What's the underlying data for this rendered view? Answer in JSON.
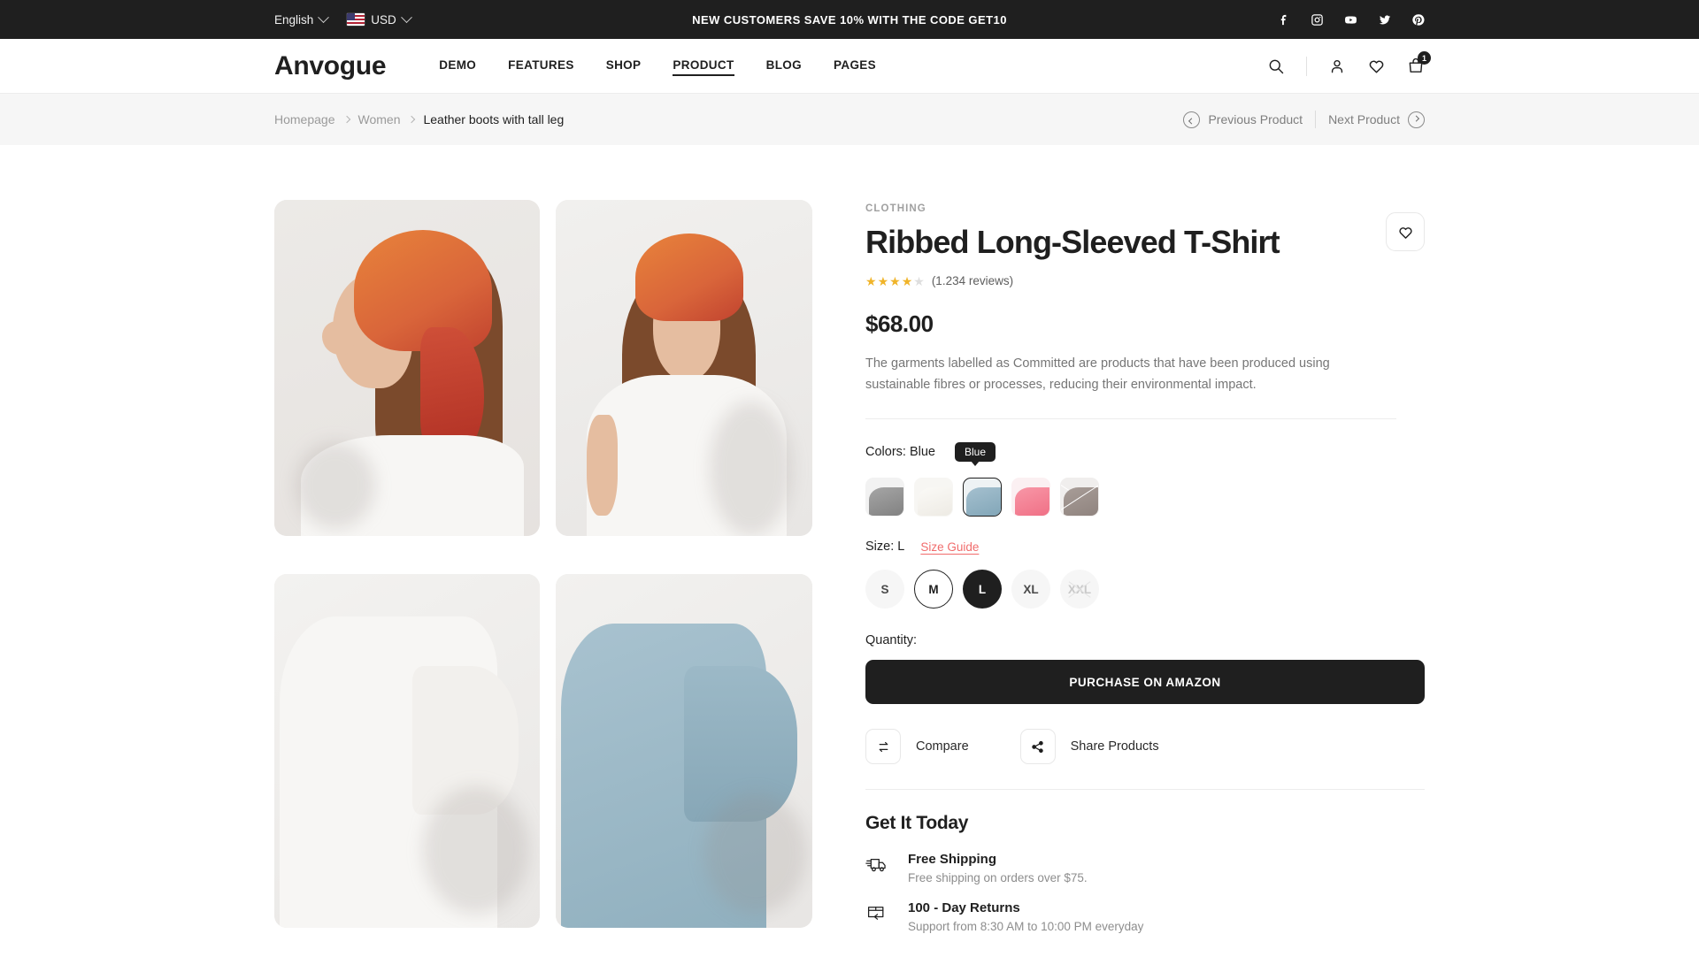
{
  "topbar": {
    "language": "English",
    "currency": "USD",
    "flag_icon": "us-flag-icon",
    "promo": "NEW CUSTOMERS SAVE 10% WITH THE CODE GET10",
    "socials": [
      {
        "name": "facebook-icon"
      },
      {
        "name": "instagram-icon"
      },
      {
        "name": "youtube-icon"
      },
      {
        "name": "twitter-icon"
      },
      {
        "name": "pinterest-icon"
      }
    ]
  },
  "header": {
    "logo": "Anvogue",
    "nav": [
      {
        "label": "DEMO",
        "active": false
      },
      {
        "label": "FEATURES",
        "active": false
      },
      {
        "label": "SHOP",
        "active": false
      },
      {
        "label": "PRODUCT",
        "active": true
      },
      {
        "label": "BLOG",
        "active": false
      },
      {
        "label": "PAGES",
        "active": false
      }
    ],
    "cart_count": "1"
  },
  "breadcrumb": {
    "items": [
      {
        "label": "Homepage",
        "current": false
      },
      {
        "label": "Women",
        "current": false
      },
      {
        "label": "Leather boots with tall leg",
        "current": true
      }
    ],
    "previous_label": "Previous Product",
    "next_label": "Next Product"
  },
  "product": {
    "category": "CLOTHING",
    "title": "Ribbed Long-Sleeved T-Shirt",
    "rating_filled": 4,
    "rating_total": 5,
    "reviews": "(1.234 reviews)",
    "price": "$68.00",
    "description": "The garments labelled as Committed are products that have been produced using sustainable fibres or processes, reducing their environmental impact.",
    "colors_label": "Colors: Blue",
    "color_tooltip": "Blue",
    "colors": [
      {
        "name": "Gray",
        "hex": "#8e8e8e",
        "bg": "#f2f2f2",
        "selected": false,
        "disabled": false
      },
      {
        "name": "White",
        "hex": "#f3f1ec",
        "bg": "#f5f4f1",
        "selected": false,
        "disabled": false
      },
      {
        "name": "Blue",
        "hex": "#8fb0c0",
        "bg": "#eef2f4",
        "selected": true,
        "disabled": false
      },
      {
        "name": "Pink",
        "hex": "#f4879a",
        "bg": "#fbf0f2",
        "selected": false,
        "disabled": false
      },
      {
        "name": "Taupe",
        "hex": "#9b8f8a",
        "bg": "#f0eeed",
        "selected": false,
        "disabled": true
      }
    ],
    "size_label": "Size: L",
    "size_guide": "Size Guide",
    "sizes": [
      {
        "label": "S",
        "state": "default"
      },
      {
        "label": "M",
        "state": "outlined"
      },
      {
        "label": "L",
        "state": "selected"
      },
      {
        "label": "XL",
        "state": "default"
      },
      {
        "label": "XXL",
        "state": "disabled"
      }
    ],
    "quantity_label": "Quantity:",
    "buy_label": "PURCHASE ON AMAZON",
    "compare_label": "Compare",
    "share_label": "Share Products"
  },
  "get_it_today": {
    "title": "Get It Today",
    "perks": [
      {
        "icon": "truck-icon",
        "title": "Free Shipping",
        "sub": "Free shipping on orders over $75."
      },
      {
        "icon": "return-box-icon",
        "title": "100 - Day Returns",
        "sub": "Support from 8:30 AM to 10:00 PM   everyday"
      }
    ]
  },
  "gallery": [
    {
      "name": "product-image-model-side",
      "alt": "Model in white tee with orange headscarf, side profile"
    },
    {
      "name": "product-image-model-front",
      "alt": "Model in white tee with orange headscarf, front"
    },
    {
      "name": "product-image-white-flat",
      "alt": "White t-shirt flat lay detail"
    },
    {
      "name": "product-image-blue-flat",
      "alt": "Blue t-shirt flat lay detail"
    }
  ]
}
